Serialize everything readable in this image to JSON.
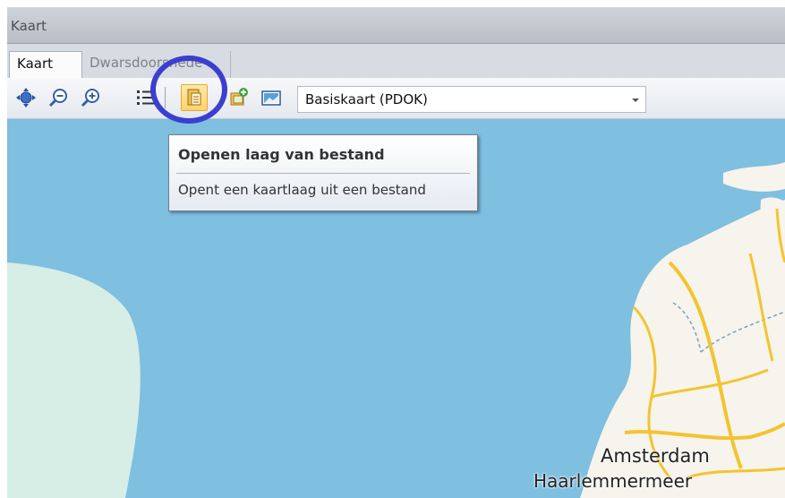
{
  "window": {
    "title": "Kaart"
  },
  "tabs": [
    {
      "label": "Kaart",
      "active": true
    },
    {
      "label": "Dwarsdoorsnede",
      "active": false
    }
  ],
  "toolbar": {
    "buttons": [
      {
        "name": "pan-icon",
        "active": false
      },
      {
        "name": "zoom-out-icon",
        "active": false
      },
      {
        "name": "zoom-in-icon",
        "active": false
      },
      {
        "name": "layer-list-icon",
        "active": false
      },
      {
        "name": "open-layer-from-file-icon",
        "active": true
      },
      {
        "name": "add-layer-icon",
        "active": false
      },
      {
        "name": "image-layer-icon",
        "active": false
      }
    ],
    "basemap_select": {
      "value": "Basiskaart (PDOK)"
    }
  },
  "tooltip": {
    "title": "Openen laag van bestand",
    "description": "Opent een kaartlaag uit een bestand"
  },
  "map": {
    "labels": [
      "Amsterdam",
      "Haarlemmermeer"
    ],
    "colors": {
      "water": "#7fbfe0",
      "land": "#f6f4ec",
      "mainland_left": "#d7eee7",
      "roads": "#f3c431"
    }
  },
  "annotation": {
    "highlight_color": "#3b3fd0"
  }
}
